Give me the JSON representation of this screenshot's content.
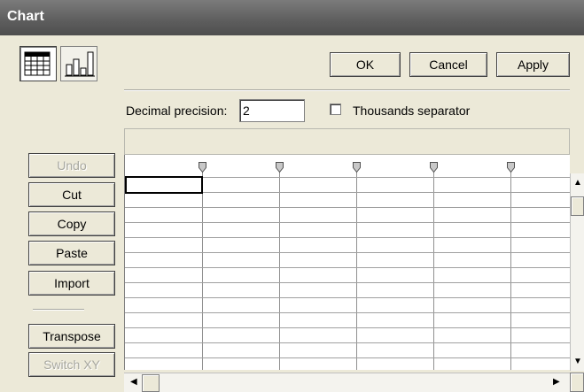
{
  "window": {
    "title": "Chart"
  },
  "toolbar": {
    "ok_label": "OK",
    "cancel_label": "Cancel",
    "apply_label": "Apply"
  },
  "view_buttons": [
    {
      "name": "datasheet-view",
      "icon": "table-grid-icon",
      "pressed": true
    },
    {
      "name": "chart-view",
      "icon": "bar-chart-icon",
      "pressed": false
    }
  ],
  "options": {
    "decimal_label": "Decimal precision:",
    "decimal_value": "2",
    "thousands_label": "Thousands separator",
    "thousands_checked": false
  },
  "side_buttons": [
    {
      "label": "Undo",
      "enabled": false
    },
    {
      "label": "Cut",
      "enabled": true
    },
    {
      "label": "Copy",
      "enabled": true
    },
    {
      "label": "Paste",
      "enabled": true
    },
    {
      "label": "Import",
      "enabled": true
    },
    {
      "label": "Transpose",
      "enabled": true
    },
    {
      "label": "Switch XY",
      "enabled": false
    }
  ],
  "grid": {
    "columns": 6,
    "rows": 14,
    "selected_cell": "row1-col1"
  },
  "colors": {
    "titlebar": "#5d5d5d",
    "face": "#ece9d8"
  }
}
